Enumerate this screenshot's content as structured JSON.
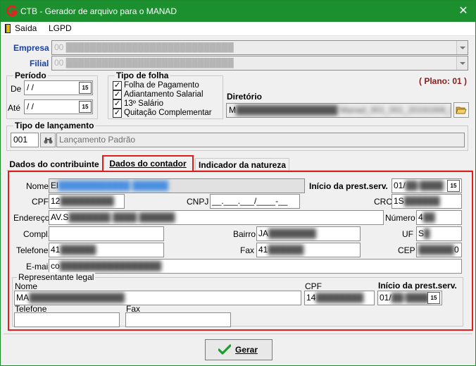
{
  "window": {
    "title": "CTB - Gerador de arquivo para o MANAD",
    "close_symbol": "✕"
  },
  "menu": {
    "items": [
      "Saída",
      "LGPD"
    ]
  },
  "empresa": {
    "label": "Empresa",
    "value": "00 ████████████████████████████"
  },
  "filial": {
    "label": "Filial",
    "value": "00 ████████████████████████████"
  },
  "periodo": {
    "title": "Período",
    "de_label": "De",
    "de_value": " / /",
    "ate_label": "Até",
    "ate_value": " / /",
    "cal_glyph": "15"
  },
  "tipo_folha": {
    "title": "Tipo de folha",
    "options": [
      {
        "label": "Folha de Pagamento",
        "checked": true
      },
      {
        "label": "Adiantamento Salarial",
        "checked": true
      },
      {
        "label": "13º Salário",
        "checked": true
      },
      {
        "label": "Quitação Complementar",
        "checked": true
      }
    ],
    "check_glyph": "✓"
  },
  "plano": "( Plano: 01 )",
  "diretorio": {
    "label": "Diretório",
    "value_prefix": "M",
    "value_blurred": "█████████████████ Manad_001_001_20191006_01122000.txt"
  },
  "tipo_lancamento": {
    "title": "Tipo de lançamento",
    "code": "001",
    "description": "Lançamento Padrão"
  },
  "tabs": [
    {
      "label": "Dados do contribuinte",
      "active": false
    },
    {
      "label": "Dados do contador",
      "active": true
    },
    {
      "label": "Indicador da natureza",
      "active": false
    }
  ],
  "contador": {
    "nome_label": "Nome",
    "nome_prefix": "El",
    "nome_blur": "████████████ ██████",
    "inicio_label": "Início da prest.serv.",
    "inicio_prefix": "01/",
    "inicio_blur": "██/████",
    "cpf_label": "CPF",
    "cpf_prefix": "12",
    "cpf_blur": "█████████",
    "cnpj_label": "CNPJ",
    "cnpj_mask": "__.___.___/____-__",
    "crc_label": "CRC",
    "crc_prefix": "1S",
    "crc_blur": "██████",
    "endereco_label": "Endereço",
    "endereco_prefix": "AV.S",
    "endereco_blur": "███████ ████ ██████",
    "numero_label": "Número",
    "numero_prefix": "4",
    "numero_blur": "██",
    "compl_label": "Compl.",
    "compl_value": "",
    "bairro_label": "Bairro",
    "bairro_prefix": "JA",
    "bairro_blur": "████████",
    "uf_label": "UF",
    "uf_prefix": "S",
    "uf_blur": "█",
    "telefone_label": "Telefone",
    "telefone_prefix": "41",
    "telefone_blur": "██████",
    "fax_label": "Fax",
    "fax_prefix": "41",
    "fax_blur": "██████",
    "cep_label": "CEP",
    "cep_blur": "██████",
    "cep_suffix": "0",
    "email_label": "E-mail",
    "email_prefix": "co",
    "email_blur": "█████████████████"
  },
  "representante": {
    "title": "Representante legal",
    "nome_label": "Nome",
    "nome_prefix": "MA",
    "nome_blur": "████████████████",
    "cpf_label": "CPF",
    "cpf_prefix": "14",
    "cpf_blur": "████████",
    "inicio_label": "Início da prest.serv.",
    "inicio_prefix": "01/",
    "inicio_blur": "██/████",
    "telefone_label": "Telefone",
    "telefone_value": "",
    "fax_label": "Fax",
    "fax_value": ""
  },
  "gerar_button": "Gerar",
  "colors": {
    "titlebar": "#1c8f2f",
    "label_blue": "#1a3fa3",
    "plano_red": "#8b1a1a",
    "highlight_red": "#e01e1e"
  }
}
